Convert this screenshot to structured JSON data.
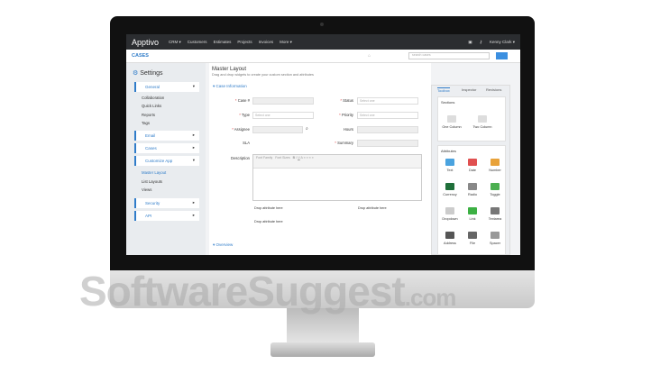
{
  "watermark": {
    "brand": "SoftwareSuggest",
    ".com": ".com",
    "suffix": ".com"
  },
  "topnav": {
    "logo": "Apptivo",
    "items": [
      "CRM ▾",
      "Customers",
      "Estimates",
      "Projects",
      "Invoices",
      "More ▾"
    ],
    "user": "Kenny Clark ▾"
  },
  "appbar": {
    "app": "CASES",
    "search_placeholder": "search cases"
  },
  "sidebar": {
    "title": "Settings",
    "general": "General",
    "general_sub": [
      "Collaboration",
      "Quick Links",
      "Reports",
      "Tags"
    ],
    "email": "Email",
    "cases": "Cases",
    "customize": "Customize App",
    "customize_sub": [
      "Master Layout",
      "List Layouts",
      "Views"
    ],
    "security": "Security",
    "api": "API"
  },
  "main": {
    "title": "Master Layout",
    "subtitle": "Drag and drop widgets to create your custom section and attributes",
    "section": "Case Information",
    "section2": "Overview",
    "fields": {
      "case": "Case #",
      "status": "Status",
      "type": "Type",
      "priority": "Priority",
      "assignee": "Assignee",
      "hours": "Hours",
      "sla": "SLA",
      "summary": "Summary",
      "description": "Description"
    },
    "select_placeholder": "Select one",
    "editor_font": "Font Family",
    "editor_size": "Font Sizes",
    "drop": "Drop attribute here"
  },
  "panel": {
    "tabs": [
      "Toolbox",
      "Inspector",
      "Revisions"
    ],
    "sections_title": "Sections",
    "sections": [
      "One Column",
      "Two Column"
    ],
    "attributes_title": "Attributes",
    "attributes": [
      "Text",
      "Date",
      "Number",
      "Currency",
      "Radio",
      "Toggle",
      "Dropdown",
      "Link",
      "Textarea",
      "Address",
      "File",
      "Spacer"
    ]
  },
  "colors": {
    "accent": "#2f7cc9",
    "topbar": "#2b2d30"
  }
}
